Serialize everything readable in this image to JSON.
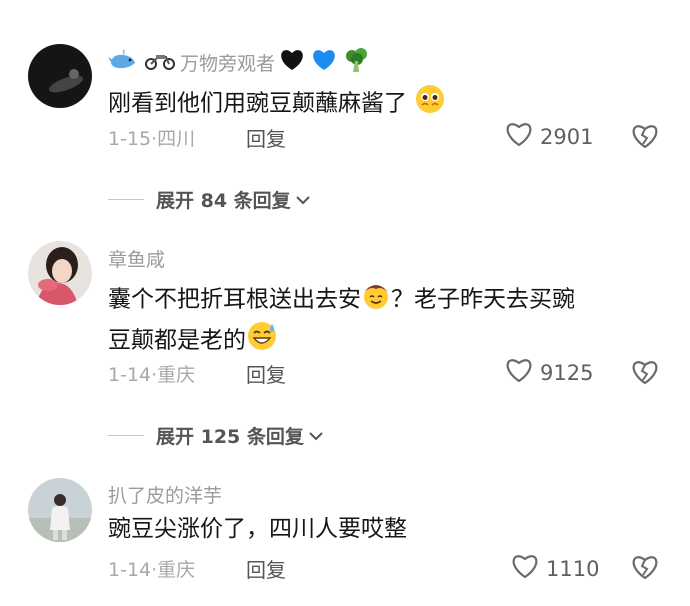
{
  "comments": [
    {
      "username": "万物旁观者",
      "text": "刚看到他们用豌豆颠蘸麻酱了",
      "date": "1-15",
      "location": "四川",
      "reply_label": "回复",
      "likes": "2901",
      "emojis": [
        "whale-emoji",
        "motorcycle-emoji",
        "black-heart-emoji",
        "blue-heart-emoji",
        "broccoli-emoji",
        "pleading-face-emoji"
      ]
    },
    {
      "username": "章鱼咸",
      "text_line1": "囊个不把折耳根送出去安",
      "text_line1b": "？老子昨天去买豌",
      "text_line2": "豆颠都是老的",
      "date": "1-14",
      "location": "重庆",
      "reply_label": "回复",
      "likes": "9125",
      "emojis": [
        "smiling-face-emoji",
        "grinning-sweat-emoji"
      ]
    },
    {
      "username": "扒了皮的洋芋",
      "text": "豌豆尖涨价了，四川人要哎整",
      "date": "1-14",
      "location": "重庆",
      "reply_label": "回复",
      "likes": "1110"
    }
  ],
  "expand1": "展开 84 条回复",
  "expand2": "展开 125 条回复",
  "separator": "·"
}
